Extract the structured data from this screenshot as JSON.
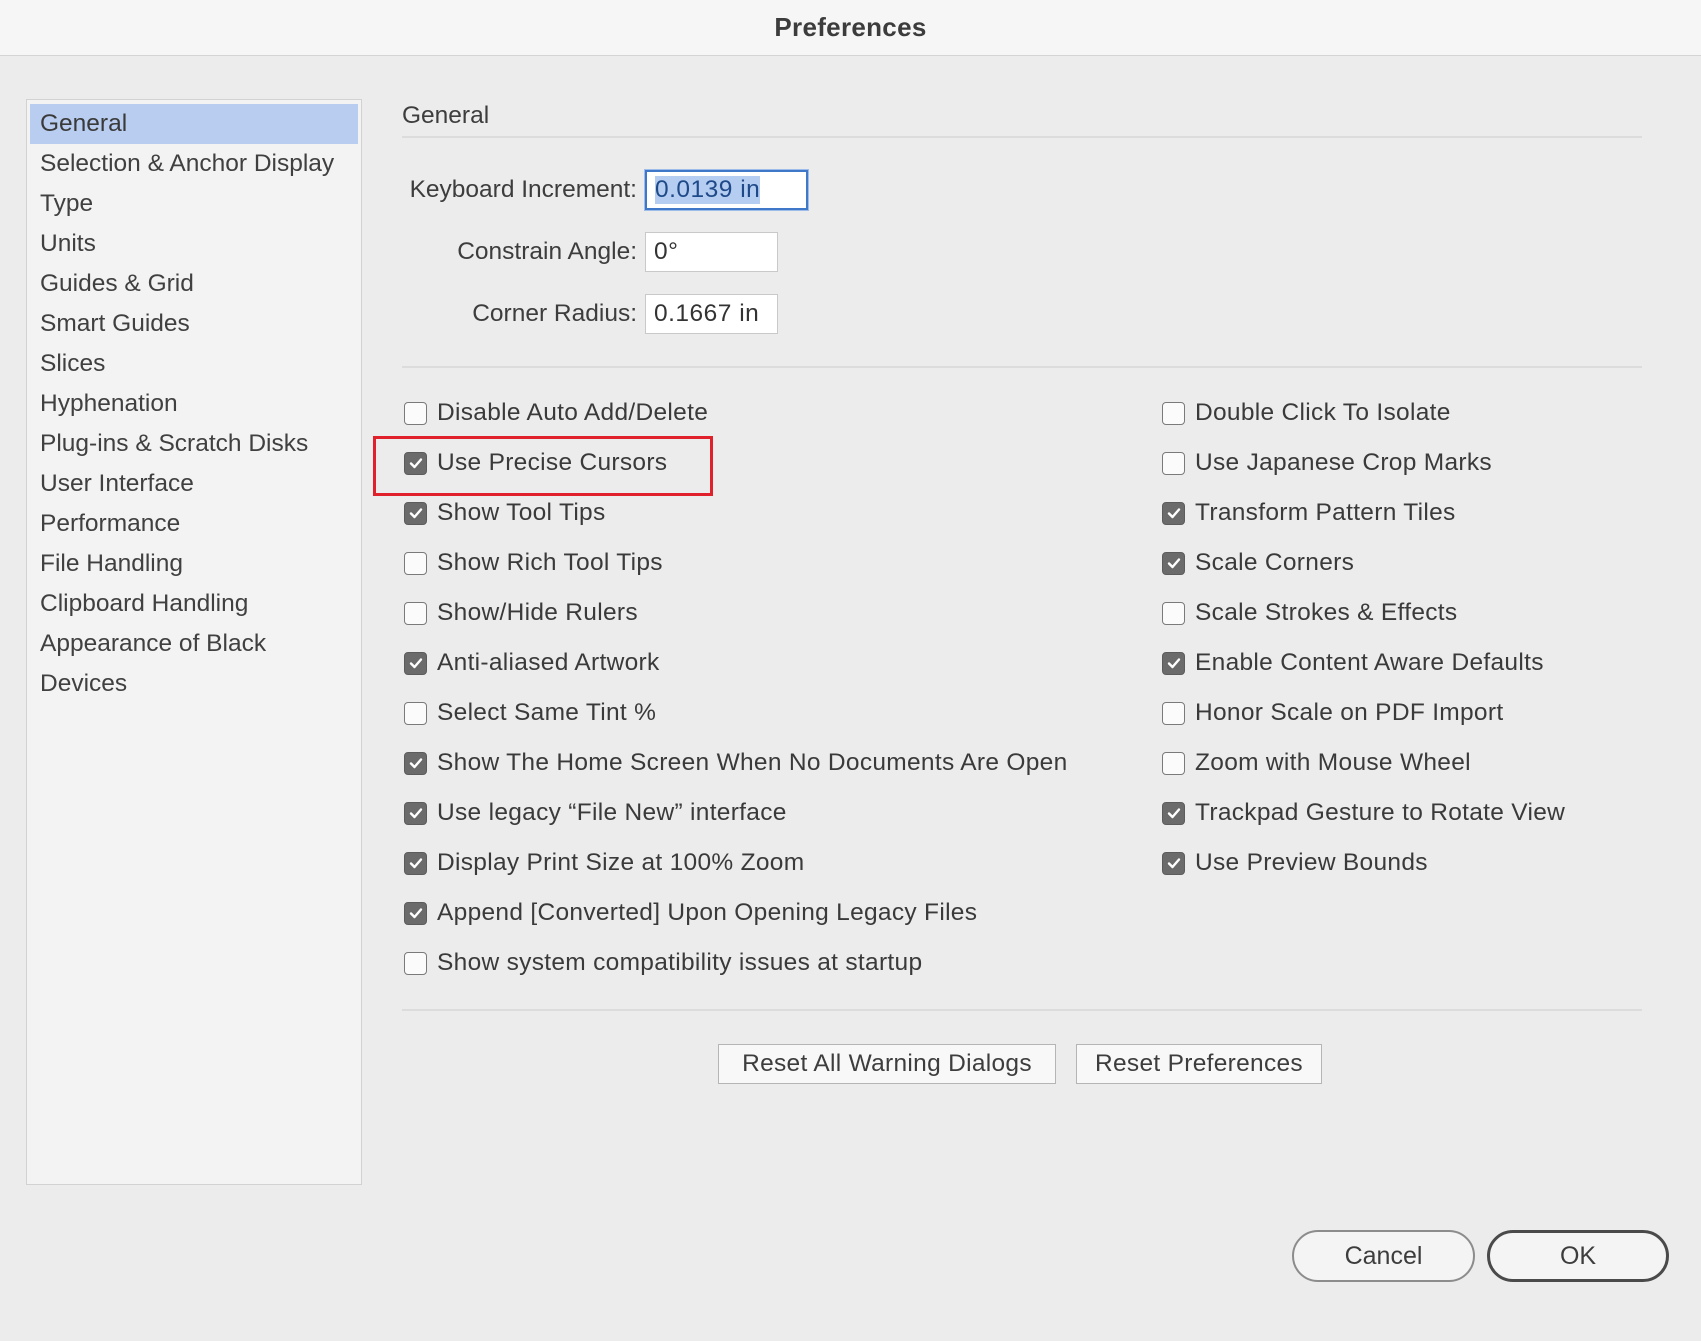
{
  "window": {
    "title": "Preferences"
  },
  "sidebar": {
    "items": [
      {
        "label": "General",
        "active": true
      },
      {
        "label": "Selection & Anchor Display",
        "active": false
      },
      {
        "label": "Type",
        "active": false
      },
      {
        "label": "Units",
        "active": false
      },
      {
        "label": "Guides & Grid",
        "active": false
      },
      {
        "label": "Smart Guides",
        "active": false
      },
      {
        "label": "Slices",
        "active": false
      },
      {
        "label": "Hyphenation",
        "active": false
      },
      {
        "label": "Plug-ins & Scratch Disks",
        "active": false
      },
      {
        "label": "User Interface",
        "active": false
      },
      {
        "label": "Performance",
        "active": false
      },
      {
        "label": "File Handling",
        "active": false
      },
      {
        "label": "Clipboard Handling",
        "active": false
      },
      {
        "label": "Appearance of Black",
        "active": false
      },
      {
        "label": "Devices",
        "active": false
      }
    ]
  },
  "main": {
    "section_title": "General",
    "fields": {
      "keyboard_increment": {
        "label": "Keyboard Increment:",
        "value": "0.0139 in"
      },
      "constrain_angle": {
        "label": "Constrain Angle:",
        "value": "0°"
      },
      "corner_radius": {
        "label": "Corner Radius:",
        "value": "0.1667 in"
      }
    },
    "left_checkboxes": [
      {
        "label": "Disable Auto Add/Delete",
        "checked": false
      },
      {
        "label": "Use Precise Cursors",
        "checked": true
      },
      {
        "label": "Show Tool Tips",
        "checked": true
      },
      {
        "label": "Show Rich Tool Tips",
        "checked": false
      },
      {
        "label": "Show/Hide Rulers",
        "checked": false
      },
      {
        "label": "Anti-aliased Artwork",
        "checked": true
      },
      {
        "label": "Select Same Tint %",
        "checked": false
      },
      {
        "label": "Show The Home Screen When No Documents Are Open",
        "checked": true
      },
      {
        "label": "Use legacy “File New” interface",
        "checked": true
      },
      {
        "label": "Display Print Size at 100% Zoom",
        "checked": true
      },
      {
        "label": "Append [Converted] Upon Opening Legacy Files",
        "checked": true
      },
      {
        "label": "Show system compatibility issues at startup",
        "checked": false
      }
    ],
    "right_checkboxes": [
      {
        "label": "Double Click To Isolate",
        "checked": false
      },
      {
        "label": "Use Japanese Crop Marks",
        "checked": false
      },
      {
        "label": "Transform Pattern Tiles",
        "checked": true
      },
      {
        "label": "Scale Corners",
        "checked": true
      },
      {
        "label": "Scale Strokes & Effects",
        "checked": false
      },
      {
        "label": "Enable Content Aware Defaults",
        "checked": true
      },
      {
        "label": "Honor Scale on PDF Import",
        "checked": false
      },
      {
        "label": "Zoom with Mouse Wheel",
        "checked": false
      },
      {
        "label": "Trackpad Gesture to Rotate View",
        "checked": true
      },
      {
        "label": "Use Preview Bounds",
        "checked": true
      }
    ],
    "buttons": {
      "reset_warnings": "Reset All Warning Dialogs",
      "reset_prefs": "Reset Preferences"
    }
  },
  "footer": {
    "cancel": "Cancel",
    "ok": "OK"
  },
  "colors": {
    "highlight": "#e0202a",
    "selection": "#b8cdf0",
    "focus": "#3f78c8"
  }
}
